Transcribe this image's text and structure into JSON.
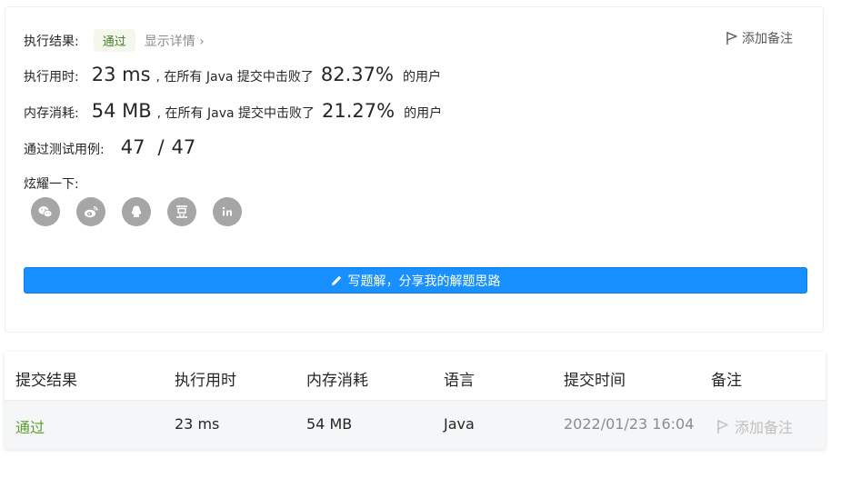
{
  "result": {
    "status_label": "执行结果:",
    "status_value": "通过",
    "details_link": "显示详情 ›",
    "add_note": "添加备注"
  },
  "runtime": {
    "label": "执行用时:",
    "value": "23 ms",
    "beat_text": ", 在所有 Java 提交中击败了",
    "percent": "82.37%",
    "suffix": "的用户"
  },
  "memory": {
    "label": "内存消耗:",
    "value": "54 MB",
    "beat_text": ", 在所有 Java 提交中击败了",
    "percent": "21.27%",
    "suffix": "的用户"
  },
  "tests": {
    "label": "通过测试用例:",
    "passed": "47",
    "sep": "/",
    "total": "47"
  },
  "share": {
    "label": "炫耀一下:",
    "icons": [
      "wechat-icon",
      "weibo-icon",
      "qq-icon",
      "douban-icon",
      "linkedin-icon"
    ],
    "icon_color": "#a6a6a6"
  },
  "solution_button": {
    "label": "写题解，分享我的解题思路",
    "color": "#1890ff"
  },
  "submissions": {
    "headers": [
      "提交结果",
      "执行用时",
      "内存消耗",
      "语言",
      "提交时间",
      "备注"
    ],
    "rows": [
      {
        "result": "通过",
        "runtime": "23 ms",
        "memory": "54 MB",
        "language": "Java",
        "time": "2022/01/23 16:04",
        "note": "添加备注"
      }
    ],
    "pass_color": "#5c9e2a"
  }
}
